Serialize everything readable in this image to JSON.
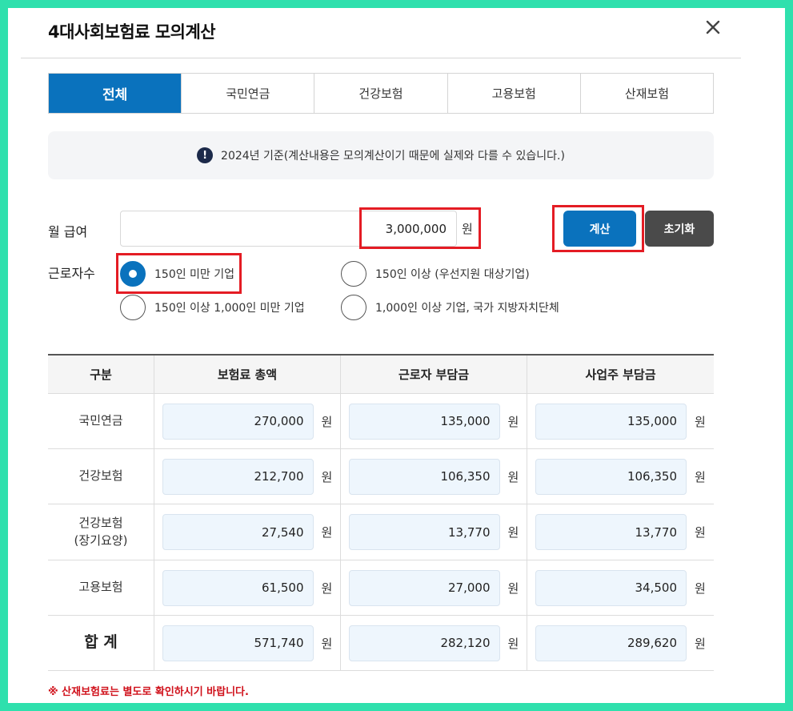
{
  "modal": {
    "title": "4대사회보험료 모의계산",
    "close_label": "×"
  },
  "tabs": [
    {
      "label": "전체",
      "active": true
    },
    {
      "label": "국민연금",
      "active": false
    },
    {
      "label": "건강보험",
      "active": false
    },
    {
      "label": "고용보험",
      "active": false
    },
    {
      "label": "산재보험",
      "active": false
    }
  ],
  "notice": {
    "icon": "!",
    "text": "2024년 기준(계산내용은 모의계산이기 때문에 실제와 다를 수 있습니다.)"
  },
  "form": {
    "salary_label": "월 급여",
    "salary_value": "3,000,000",
    "salary_unit": "원",
    "calc_button": "계산",
    "reset_button": "초기화",
    "workers_label": "근로자수",
    "options": [
      {
        "label": "150인 미만 기업",
        "checked": true
      },
      {
        "label": "150인 이상 (우선지원 대상기업)",
        "checked": false
      },
      {
        "label": "150인 이상 1,000인 미만 기업",
        "checked": false
      },
      {
        "label": "1,000인 이상 기업, 국가 지방자치단체",
        "checked": false
      }
    ]
  },
  "table": {
    "headers": [
      "구분",
      "보험료 총액",
      "근로자 부담금",
      "사업주 부담금"
    ],
    "unit": "원",
    "rows": [
      {
        "label": "국민연금",
        "total": "270,000",
        "worker": "135,000",
        "employer": "135,000"
      },
      {
        "label": "건강보험",
        "total": "212,700",
        "worker": "106,350",
        "employer": "106,350"
      },
      {
        "label": "건강보험\n(장기요양)",
        "total": "27,540",
        "worker": "13,770",
        "employer": "13,770"
      },
      {
        "label": "고용보험",
        "total": "61,500",
        "worker": "27,000",
        "employer": "34,500"
      },
      {
        "label": "합 계",
        "total": "571,740",
        "worker": "282,120",
        "employer": "289,620"
      }
    ]
  },
  "footnote": "※ 산재보험료는 별도로 확인하시기 바랍니다.",
  "colors": {
    "accent": "#0a72bd",
    "highlight": "#e41c24",
    "frame": "#2fe0ad"
  }
}
